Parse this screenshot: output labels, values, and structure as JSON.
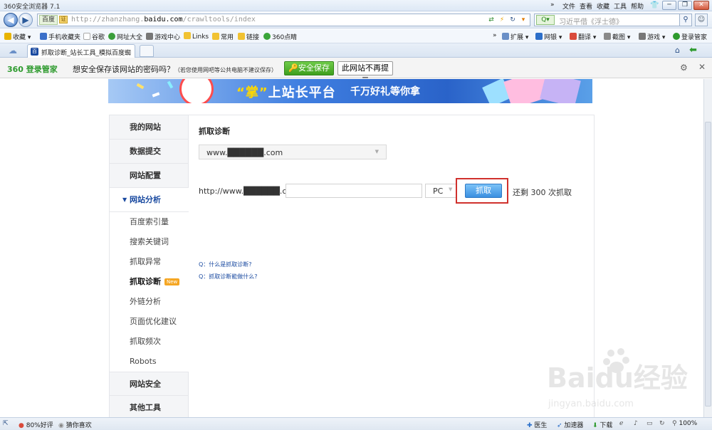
{
  "browser": {
    "title": "360安全浏览器 7.1",
    "menu": [
      "文件",
      "查看",
      "收藏",
      "工具",
      "帮助"
    ],
    "window_controls": [
      "minimize",
      "restore",
      "close"
    ],
    "nav_more": "»",
    "address": {
      "engine": "百度",
      "url_prefix": "http://zhanzhang.",
      "url_domain": "baidu.com",
      "url_suffix": "/crawltools/index"
    },
    "search": {
      "engine": "Q",
      "placeholder": "习近平借《浮士德》"
    },
    "favorites": [
      {
        "label": "收藏",
        "icon": "star-icon",
        "color": "#e8b400"
      },
      {
        "label": "手机收藏夹",
        "icon": "phone-icon",
        "color": "#3a6fc9"
      },
      {
        "label": "谷歌",
        "icon": "page-icon",
        "color": "#bbbbbb"
      },
      {
        "label": "网址大全",
        "icon": "globe-icon",
        "color": "#3a9e3a"
      },
      {
        "label": "游戏中心",
        "icon": "gamepad-icon",
        "color": "#666666"
      },
      {
        "label": "Links",
        "icon": "folder-icon",
        "color": "#f1c232"
      },
      {
        "label": "常用",
        "icon": "folder-icon",
        "color": "#f1c232"
      },
      {
        "label": "链接",
        "icon": "folder-icon",
        "color": "#f1c232"
      },
      {
        "label": "360点睛",
        "icon": "360-icon",
        "color": "#3aa53a"
      }
    ],
    "toolbar_right": [
      {
        "label": "扩展",
        "icon": "grid-icon"
      },
      {
        "label": "网银",
        "icon": "bank-icon"
      },
      {
        "label": "翻译",
        "icon": "translate-icon"
      },
      {
        "label": "截图",
        "icon": "scissors-icon"
      },
      {
        "label": "游戏",
        "icon": "gamepad-icon"
      },
      {
        "label": "登录管家",
        "icon": "user-icon"
      }
    ],
    "tab": {
      "label": "抓取诊断_站长工具_模拟百度蜘"
    },
    "password_bar": {
      "logo": "360 登录管家",
      "message": "想安全保存该网站的密码吗？",
      "note": "（若您使用网吧等公共电脑不建议保存）",
      "save_label": "安全保存",
      "never_label": "此网站不再提示"
    },
    "status": {
      "rating": "80%好评",
      "guess": "猜你喜欢",
      "doctor": "医生",
      "accelerator": "加速器",
      "download": "下载",
      "zoom": "100%"
    }
  },
  "banner": {
    "quote_char": "“掌”",
    "text1": "上站长平台",
    "text2": "千万好礼等你拿"
  },
  "sidebar": {
    "main": [
      "我的网站",
      "数据提交",
      "网站配置"
    ],
    "analysis": {
      "label": "网站分析",
      "items": [
        "百度索引量",
        "搜索关键词",
        "抓取异常",
        "抓取诊断",
        "外链分析",
        "页面优化建议",
        "抓取频次",
        "Robots"
      ],
      "current_index": 3,
      "badge": "New"
    },
    "bottom": [
      "网站安全",
      "其他工具"
    ]
  },
  "main": {
    "heading": "抓取诊断",
    "site": "www.██████.com",
    "url_prefix": "http://www.██████.com/",
    "path_value": "",
    "ua": "PC",
    "fetch_label": "抓取",
    "remaining": "还剩 300 次抓取",
    "faq": [
      "Q：什么是抓取诊断?",
      "Q：抓取诊断能做什么?"
    ]
  },
  "watermark": {
    "big": "Baidu经验",
    "small": "jingyan.baidu.com"
  }
}
